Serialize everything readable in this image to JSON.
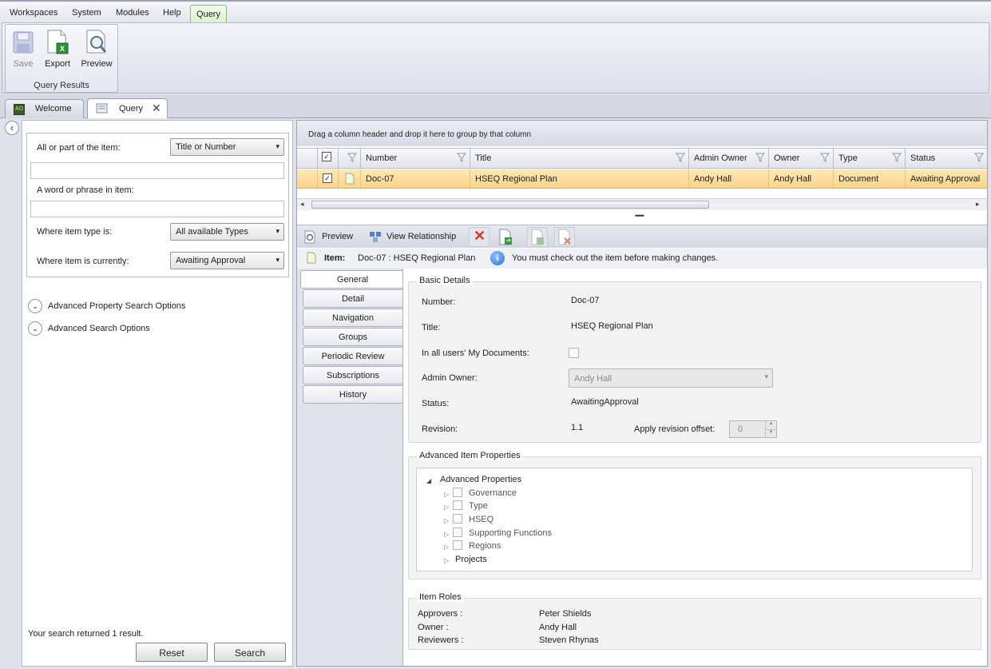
{
  "menu": {
    "items": [
      "Workspaces",
      "System",
      "Modules",
      "Help"
    ],
    "active": "Query"
  },
  "ribbon": {
    "buttons": {
      "save": "Save",
      "export": "Export",
      "preview": "Preview"
    },
    "group_label": "Query Results"
  },
  "doc_tabs": {
    "welcome": "Welcome",
    "query": "Query"
  },
  "search": {
    "item_label": "All or part of the item:",
    "item_mode": "Title or Number",
    "item_value": "",
    "phrase_label": "A word or phrase in item:",
    "phrase_value": "",
    "type_label": "Where item type is:",
    "type_value": "All available Types",
    "status_label": "Where item is currently:",
    "status_value": "Awaiting Approval",
    "adv_property": "Advanced Property Search Options",
    "adv_search": "Advanced Search Options",
    "result_text": "Your search returned 1 result.",
    "reset": "Reset",
    "search": "Search"
  },
  "grid": {
    "group_hint": "Drag a column header and drop it here to group by that column",
    "columns": {
      "number": "Number",
      "title": "Title",
      "admin_owner": "Admin Owner",
      "owner": "Owner",
      "type": "Type",
      "status": "Status"
    },
    "rows": [
      {
        "number": "Doc-07",
        "title": "HSEQ Regional Plan",
        "admin_owner": "Andy Hall",
        "owner": "Andy Hall",
        "type": "Document",
        "status": "Awaiting Approval"
      }
    ]
  },
  "detail": {
    "toolbar": {
      "preview": "Preview",
      "view_relationship": "View Relationship"
    },
    "item_label": "Item:",
    "item_value": "Doc-07 : HSEQ Regional Plan",
    "info_message": "You must check out the item before making changes.",
    "tabs": [
      "General",
      "Detail",
      "Navigation",
      "Groups",
      "Periodic Review",
      "Subscriptions",
      "History"
    ],
    "basic": {
      "legend": "Basic Details",
      "number_label": "Number:",
      "number": "Doc-07",
      "title_label": "Title:",
      "title": "HSEQ Regional Plan",
      "mydocs_label": "In all users' My Documents:",
      "admin_owner_label": "Admin Owner:",
      "admin_owner": "Andy Hall",
      "status_label": "Status:",
      "status": "AwaitingApproval",
      "revision_label": "Revision:",
      "revision": "1.1",
      "offset_label": "Apply revision offset:",
      "offset": "0"
    },
    "advanced": {
      "legend": "Advanced Item Properties",
      "root": "Advanced Properties",
      "children": [
        "Governance",
        "Type",
        "HSEQ",
        "Supporting Functions",
        "Regions"
      ],
      "projects": "Projects"
    },
    "roles": {
      "legend": "Item Roles",
      "approvers_label": "Approvers :",
      "approvers": "Peter Shields",
      "owner_label": "Owner :",
      "owner": "Andy Hall",
      "reviewers_label": "Reviewers :",
      "reviewers": "Steven Rhynas"
    }
  }
}
